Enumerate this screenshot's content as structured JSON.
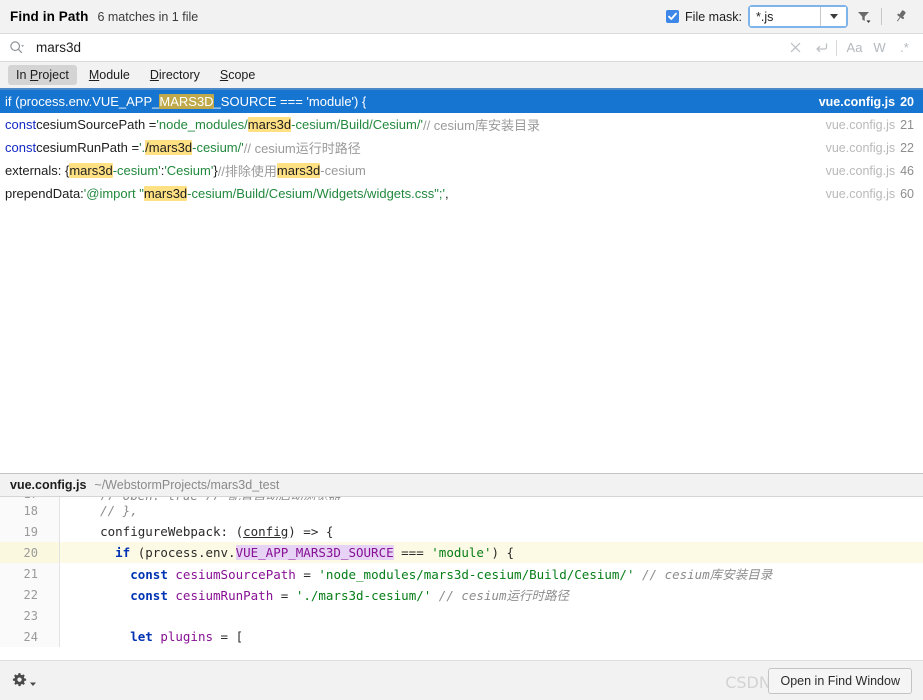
{
  "titlebar": {
    "title": "Find in Path",
    "matches_summary": "6 matches in 1 file",
    "file_mask_label": "File mask:",
    "file_mask_value": "*.js",
    "file_mask_checked": true,
    "filter_icon": "filter-icon",
    "pin_icon": "pin-icon"
  },
  "search": {
    "value": "mars3d",
    "placeholder": "",
    "search_icon": "search-icon",
    "clear_icon": "clear-icon",
    "newline_icon": "new-line-icon",
    "match_case_label": "Aa",
    "words_label": "W",
    "regex_label": ".*"
  },
  "tabs": [
    {
      "label": "In Project",
      "selected": true
    },
    {
      "label": "Module",
      "selected": false
    },
    {
      "label": "Directory",
      "selected": false
    },
    {
      "label": "Scope",
      "selected": false
    }
  ],
  "results": [
    {
      "selected": true,
      "file": "vue.config.js",
      "line": "20",
      "segments": [
        {
          "text": "if (process.env.VUE_APP_",
          "kind": "def"
        },
        {
          "text": "MARS3D",
          "kind": "hl"
        },
        {
          "text": "_SOURCE === 'module') {",
          "kind": "def"
        }
      ]
    },
    {
      "selected": false,
      "file": "vue.config.js",
      "line": "21",
      "segments": [
        {
          "text": "const ",
          "kind": "kw"
        },
        {
          "text": "cesiumSourcePath = ",
          "kind": "def"
        },
        {
          "text": "'node_modules/",
          "kind": "str"
        },
        {
          "text": "mars3d",
          "kind": "hl"
        },
        {
          "text": "-cesium/Build/Cesium/'",
          "kind": "str"
        },
        {
          "text": " // cesium库安装目录",
          "kind": "cmt"
        }
      ]
    },
    {
      "selected": false,
      "file": "vue.config.js",
      "line": "22",
      "segments": [
        {
          "text": "const ",
          "kind": "kw"
        },
        {
          "text": "cesiumRunPath = ",
          "kind": "def"
        },
        {
          "text": "'.",
          "kind": "str"
        },
        {
          "text": "/mars3d",
          "kind": "hl"
        },
        {
          "text": "-cesium/'",
          "kind": "str"
        },
        {
          "text": " // cesium运行时路径",
          "kind": "cmt"
        }
      ]
    },
    {
      "selected": false,
      "file": "vue.config.js",
      "line": "46",
      "segments": [
        {
          "text": "externals: { ",
          "kind": "def"
        },
        {
          "text": "mars3d",
          "kind": "hl"
        },
        {
          "text": "-cesium'",
          "kind": "str"
        },
        {
          "text": ": ",
          "kind": "def"
        },
        {
          "text": "'Cesium'",
          "kind": "str"
        },
        {
          "text": " } ",
          "kind": "def"
        },
        {
          "text": "//排除使用 ",
          "kind": "cmt"
        },
        {
          "text": "mars3d",
          "kind": "hl"
        },
        {
          "text": "-cesium",
          "kind": "cmt"
        }
      ]
    },
    {
      "selected": false,
      "file": "vue.config.js",
      "line": "60",
      "segments": [
        {
          "text": "prependData: ",
          "kind": "def"
        },
        {
          "text": "'@import \"",
          "kind": "str"
        },
        {
          "text": "mars3d",
          "kind": "hl"
        },
        {
          "text": "-cesium/Build/Cesium/Widgets/widgets.css\";'",
          "kind": "str"
        },
        {
          "text": ",",
          "kind": "def"
        }
      ]
    }
  ],
  "preview": {
    "file": "vue.config.js",
    "path": "~/WebstormProjects/mars3d_test",
    "lines": [
      {
        "num": "17",
        "clipped": true,
        "segments": [
          {
            "text": "    // open: true // 配置自动启动浏览器",
            "kind": "cmt"
          }
        ]
      },
      {
        "num": "18",
        "current": false,
        "segments": [
          {
            "text": "    // },",
            "kind": "cmt"
          }
        ]
      },
      {
        "num": "19",
        "current": false,
        "segments": [
          {
            "text": "    configureWebpack: (",
            "kind": "plain"
          },
          {
            "text": "config",
            "kind": "underline"
          },
          {
            "text": ") => {",
            "kind": "plain"
          }
        ]
      },
      {
        "num": "20",
        "current": true,
        "segments": [
          {
            "text": "      ",
            "kind": "plain"
          },
          {
            "text": "if",
            "kind": "kw"
          },
          {
            "text": " (process.env.",
            "kind": "plain"
          },
          {
            "text": "VUE_APP_MARS3D_SOURCE",
            "kind": "var-hl"
          },
          {
            "text": " === ",
            "kind": "plain"
          },
          {
            "text": "'module'",
            "kind": "str"
          },
          {
            "text": ") {",
            "kind": "plain"
          }
        ]
      },
      {
        "num": "21",
        "current": false,
        "segments": [
          {
            "text": "        ",
            "kind": "plain"
          },
          {
            "text": "const",
            "kind": "kw"
          },
          {
            "text": " ",
            "kind": "plain"
          },
          {
            "text": "cesiumSourcePath",
            "kind": "var"
          },
          {
            "text": " = ",
            "kind": "plain"
          },
          {
            "text": "'node_modules/mars3d-cesium/Build/Cesium/'",
            "kind": "str"
          },
          {
            "text": " // cesium库安装目录",
            "kind": "cmt"
          }
        ]
      },
      {
        "num": "22",
        "current": false,
        "segments": [
          {
            "text": "        ",
            "kind": "plain"
          },
          {
            "text": "const",
            "kind": "kw"
          },
          {
            "text": " ",
            "kind": "plain"
          },
          {
            "text": "cesiumRunPath",
            "kind": "var"
          },
          {
            "text": " = ",
            "kind": "plain"
          },
          {
            "text": "'./mars3d-cesium/'",
            "kind": "str"
          },
          {
            "text": " // cesium运行时路径",
            "kind": "cmt"
          }
        ]
      },
      {
        "num": "23",
        "current": false,
        "segments": [
          {
            "text": "",
            "kind": "plain"
          }
        ]
      },
      {
        "num": "24",
        "current": false,
        "segments": [
          {
            "text": "        ",
            "kind": "plain"
          },
          {
            "text": "let",
            "kind": "kw"
          },
          {
            "text": " ",
            "kind": "plain"
          },
          {
            "text": "plugins",
            "kind": "var"
          },
          {
            "text": " = [",
            "kind": "plain"
          }
        ]
      }
    ]
  },
  "bottom": {
    "settings_icon": "gear-icon",
    "open_button_label": "Open in Find Window",
    "watermark": "CSDN @教练,我想打篮球"
  },
  "colors": {
    "selection_blue": "#1675d1",
    "match_highlight": "#ffe083",
    "keyword": "#1328c4",
    "string": "#22883d",
    "comment": "#9a9a9a",
    "accent_underline": "#4a88c7",
    "editor_current_line": "#fcfae4",
    "editor_var_highlight": "#e6d3f5"
  }
}
